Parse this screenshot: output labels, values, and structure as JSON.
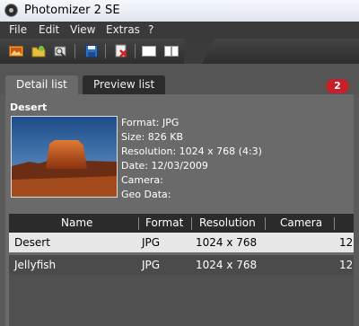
{
  "window": {
    "title": "Photomizer 2 SE"
  },
  "menu": {
    "items": [
      "File",
      "Edit",
      "View",
      "Extras",
      "?"
    ]
  },
  "toolbar": {
    "buttons": [
      "open-image-icon",
      "open-folder-icon",
      "scan-icon",
      "save-icon",
      "remove-icon",
      "single-view-icon",
      "split-view-icon"
    ]
  },
  "tabs": {
    "detail_label": "Detail list",
    "preview_label": "Preview list",
    "badge": "2"
  },
  "detail": {
    "title": "Desert",
    "format": "Format: JPG",
    "size": "Size: 826 KB",
    "resolution": "Resolution: 1024 x 768 (4:3)",
    "date": "Date: 12/03/2009",
    "camera": "Camera:",
    "geo": "Geo Data:"
  },
  "table": {
    "columns": [
      "Name",
      "Format",
      "Resolution",
      "Camera"
    ],
    "rows": [
      {
        "name": "Desert",
        "format": "JPG",
        "resolution": "1024 x 768",
        "camera": "12"
      },
      {
        "name": "Jellyfish",
        "format": "JPG",
        "resolution": "1024 x 768",
        "camera": "12"
      }
    ]
  },
  "colors": {
    "badge": "#c8202a",
    "background": "#5a5a5a",
    "selected_row": "#e7e7e7"
  }
}
